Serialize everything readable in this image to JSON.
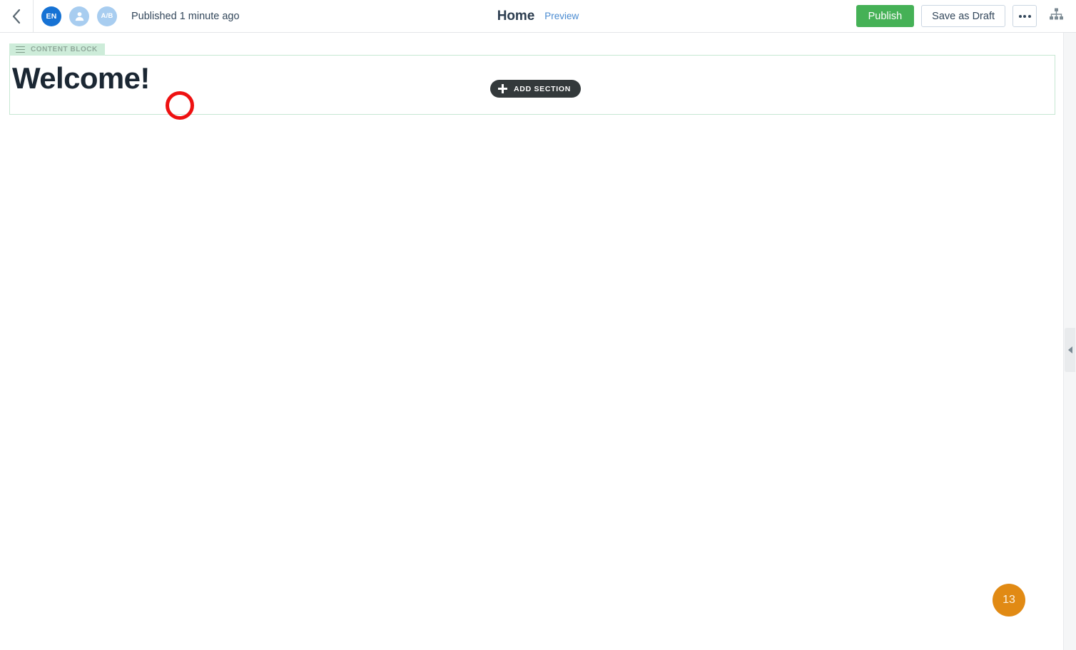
{
  "topbar": {
    "back_icon": "chevron-left-icon",
    "badges": [
      {
        "id": "language",
        "label": "EN",
        "icon": "language-badge"
      },
      {
        "id": "persona",
        "label": "",
        "icon": "person-icon"
      },
      {
        "id": "ab-test",
        "label": "A/B",
        "icon": "ab-test-badge"
      }
    ],
    "status_text": "Published 1 minute ago",
    "page_title": "Home",
    "preview_label": "Preview",
    "publish_label": "Publish",
    "save_draft_label": "Save as Draft",
    "more_icon": "ellipsis-icon",
    "sitemap_icon": "sitemap-icon"
  },
  "canvas": {
    "add_section_label": "ADD SECTION",
    "add_section_icon": "plus-icon",
    "content_block": {
      "tab_label": "CONTENT BLOCK",
      "tab_icon": "hamburger-icon",
      "heading": "Welcome!"
    },
    "annotation": {
      "shape": "circle",
      "color": "#ee1111"
    }
  },
  "right_panel": {
    "handle_icon": "chevron-left-icon"
  },
  "floating_badge": {
    "count": "13",
    "color": "#e18a14"
  },
  "colors": {
    "publish_green": "#45b156",
    "link_blue": "#4a8bd1",
    "lang_badge_blue": "#1672d4",
    "soft_badge_blue": "#a8cdf0",
    "block_green": "#cdecd9",
    "rail_dark": "#2f3233",
    "annotation_red": "#ee1111",
    "badge_orange": "#e18a14"
  }
}
